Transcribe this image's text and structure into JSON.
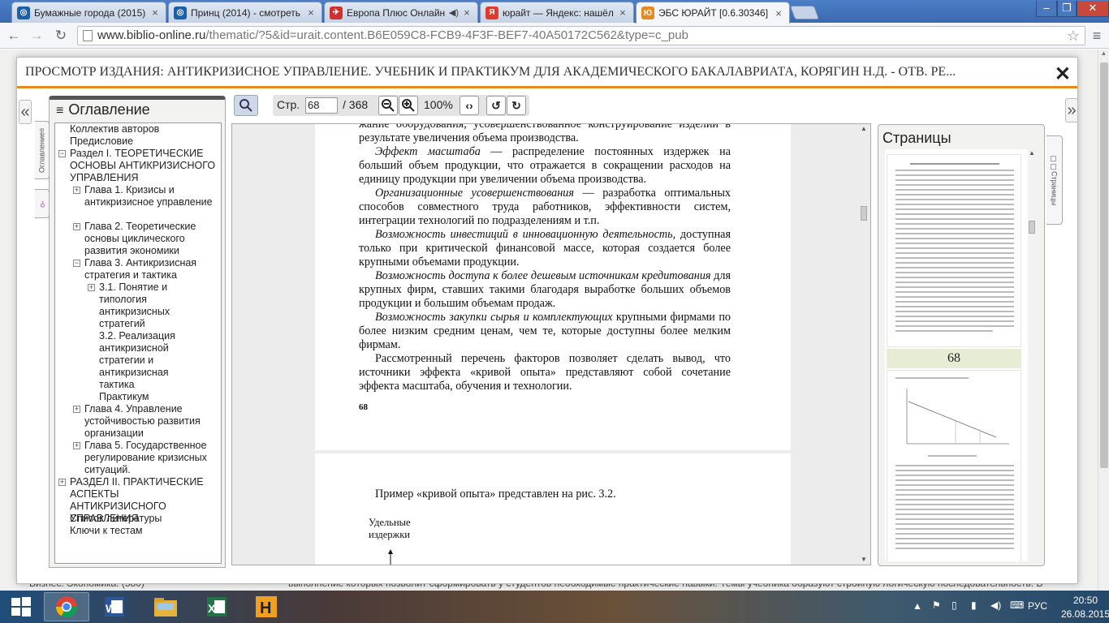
{
  "browser": {
    "tabs": [
      {
        "title": "Бумажные города (2015)",
        "icon": "film-site-icon",
        "color": "#1a5fa8"
      },
      {
        "title": "Принц (2014) - смотреть",
        "icon": "film-site-icon",
        "color": "#1a5fa8"
      },
      {
        "title": "Европа Плюс Онлайн",
        "icon": "radio-icon",
        "color": "#d0312d"
      },
      {
        "title": "юрайт — Яндекс: нашёл",
        "icon": "yandex-icon",
        "color": "#e03a2f"
      },
      {
        "title": "ЭБС ЮРАЙТ [0.6.30346]",
        "icon": "urait-icon",
        "color": "#e8891c"
      }
    ],
    "url_host": "www.biblio-online.ru",
    "url_path": "/thematic/?5&id=urait.content.B6E059C8-FCB9-4F3F-BEF7-40A50172C562&type=c_pub"
  },
  "modal": {
    "title": "ПРОСМОТР ИЗДАНИЯ: АНТИКРИЗИСНОЕ УПРАВЛЕНИЕ. УЧЕБНИК И ПРАКТИКУМ ДЛЯ АКАДЕМИЧЕСКОГО БАКАЛАВРИАТА, КОРЯГИН Н.Д. - ОТВ. РЕ...",
    "toc_heading": "Оглавление",
    "toc_side_tab": "Оглавление",
    "pages_heading": "Страницы",
    "pages_side_tab": "Страницы",
    "accent": "#e8891c"
  },
  "toolbar": {
    "page_label": "Стр.",
    "page_value": "68",
    "page_total": "/ 368",
    "zoom": "100%"
  },
  "toc": [
    {
      "label": "Коллектив авторов",
      "level": 0,
      "toggle": ""
    },
    {
      "label": "Предисловие",
      "level": 0,
      "toggle": ""
    },
    {
      "label": "Раздел I. ТЕОРЕТИЧЕСКИЕ ОСНОВЫ АНТИКРИЗИСНОГО УПРАВЛЕНИЯ",
      "level": 0,
      "toggle": "−"
    },
    {
      "label": "Глава 1. Кризисы и антикризисное управление",
      "level": 1,
      "toggle": "+"
    },
    {
      "label": "Глава 2. Теоретические основы циклического развития экономики",
      "level": 1,
      "toggle": "+"
    },
    {
      "label": "Глава 3. Антикризисная стратегия и тактика",
      "level": 1,
      "toggle": "−"
    },
    {
      "label": "3.1. Понятие и типология антикризисных стратегий",
      "level": 2,
      "toggle": "+"
    },
    {
      "label": "3.2. Реализация антикризисной стратегии и антикризисная тактика",
      "level": 2,
      "toggle": ""
    },
    {
      "label": "Практикум",
      "level": 2,
      "toggle": ""
    },
    {
      "label": "Глава 4. Управление устойчивостью развития организации",
      "level": 1,
      "toggle": "+"
    },
    {
      "label": "Глава 5. Государственное регулирование кризисных ситуаций.",
      "level": 1,
      "toggle": "+"
    },
    {
      "label": "РАЗДЕЛ II. ПРАКТИЧЕСКИЕ АСПЕКТЫ АНТИКРИЗИСНОГО УПРАВЛЕНИЯ",
      "level": 0,
      "toggle": "+"
    },
    {
      "label": "Список литературы",
      "level": 0,
      "toggle": ""
    },
    {
      "label": "Ключи к тестам",
      "level": 0,
      "toggle": ""
    }
  ],
  "page68": {
    "p0": "жание оборудования, усовершенствованное конструирование изделий в результате увеличения объема производства.",
    "p1_em": "Эффект масштаба",
    "p1": " — распределение постоянных издержек на больший объем продукции, что отражается в сокращении расходов на единицу продукции при увеличении объема производства.",
    "p2_em": "Организационные усовершенствования",
    "p2": " — разработка оптимальных способов совместного труда работников, эффективности систем, интеграции технологий по подразделениям и т.п.",
    "p3_em": "Возможность инвестиций в инновационную деятельность,",
    "p3": " доступная только при критической финансовой массе, которая создается более крупными объемами продукции.",
    "p4_em": "Возможность доступа к более дешевым источникам кредитования",
    "p4": " для крупных фирм, ставших такими благодаря выработке больших объемов продукции и большим объемам продаж.",
    "p5_em": "Возможность закупки сырья и комплектующих",
    "p5": " крупными фирмами по более низким средним ценам, чем те, которые доступны более мелким фирмам.",
    "p6": "Рассмотренный перечень факторов позволяет сделать вывод, что источники эффекта «кривой опыта» представляют собой сочетание эффекта масштаба, обучения и технологии.",
    "page_number": "68"
  },
  "page69": {
    "intro": "Пример «кривой опыта» представлен на рис. 3.2.",
    "axis_label": "Удельные издержки"
  },
  "thumbs": {
    "current_number": "68"
  },
  "background_page": {
    "category": "Бизнес. Экономика. (580)",
    "description": "выполнение которых позволит сформировать у студентов необходимые практические навыки. Темы учебника образуют стройную логическую последовательность. В"
  },
  "taskbar": {
    "apps": [
      "windows-start-icon",
      "chrome-icon",
      "word-icon",
      "explorer-icon",
      "excel-icon",
      "h-app-icon"
    ],
    "lang": "РУС",
    "time": "20:50",
    "date": "26.08.2015"
  }
}
